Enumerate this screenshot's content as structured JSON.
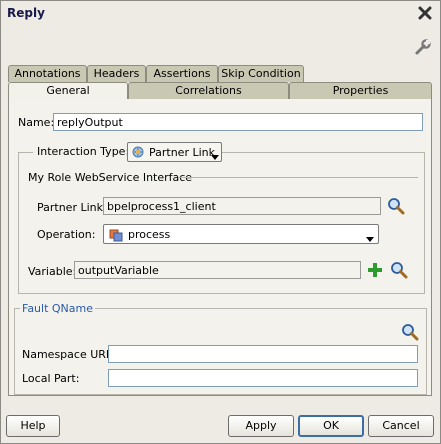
{
  "dialog": {
    "title": "Reply"
  },
  "tabs_row1": [
    "Annotations",
    "Headers",
    "Assertions",
    "Skip Condition"
  ],
  "tabs_row2": [
    "General",
    "Correlations",
    "Properties"
  ],
  "general": {
    "name_label": "Name:",
    "name_value": "replyOutput",
    "interaction_type_label": "Interaction Type:",
    "interaction_type_value": "Partner Link",
    "my_role_heading": "My Role WebService Interface",
    "partner_link_label": "Partner Link:",
    "partner_link_value": "bpelprocess1_client",
    "operation_label": "Operation:",
    "operation_value": "process",
    "variable_label": "Variable:",
    "variable_value": "outputVariable"
  },
  "fault": {
    "heading": "Fault QName",
    "namespace_label": "Namespace URI:",
    "namespace_value": "",
    "local_part_label": "Local Part:",
    "local_part_value": ""
  },
  "buttons": {
    "help": "Help",
    "apply": "Apply",
    "ok": "OK",
    "cancel": "Cancel"
  },
  "icons": {
    "close": "close-icon",
    "wrench": "wrench-icon",
    "search": "search-icon",
    "add": "add-icon",
    "partner_link": "partner-link-icon",
    "operation": "operation-icon",
    "dropdown": "chevron-down-icon"
  },
  "colors": {
    "accent": "#3a6ea5",
    "fault_heading": "#2a5aa8",
    "add_icon": "#2e9b2e"
  }
}
